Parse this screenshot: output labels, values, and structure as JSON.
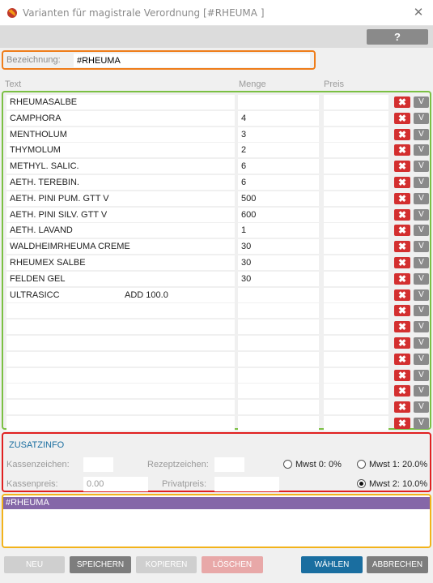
{
  "window": {
    "title": "Varianten für magistrale Verordnung [#RHEUMA ]",
    "close_glyph": "✕",
    "app_icon": "pharmacy-app-icon"
  },
  "toolbar": {
    "help_label": "?"
  },
  "bezeichnung": {
    "label": "Bezeichnung:",
    "value": "#RHEUMA"
  },
  "columns": {
    "text": "Text",
    "menge": "Menge",
    "preis": "Preis"
  },
  "row_buttons": {
    "delete_glyph": "✖",
    "v_label": "V"
  },
  "rows": [
    {
      "text": "RHEUMASALBE",
      "extra": "",
      "menge": "",
      "preis": ""
    },
    {
      "text": "CAMPHORA",
      "extra": "",
      "menge": "4",
      "preis": ""
    },
    {
      "text": "MENTHOLUM",
      "extra": "",
      "menge": "3",
      "preis": ""
    },
    {
      "text": "THYMOLUM",
      "extra": "",
      "menge": "2",
      "preis": ""
    },
    {
      "text": "METHYL. SALIC.",
      "extra": "",
      "menge": "6",
      "preis": ""
    },
    {
      "text": "AETH. TEREBIN.",
      "extra": "",
      "menge": "6",
      "preis": ""
    },
    {
      "text": "AETH. PINI PUM. GTT V",
      "extra": "",
      "menge": "500",
      "preis": ""
    },
    {
      "text": "AETH. PINI SILV. GTT V",
      "extra": "",
      "menge": "600",
      "preis": ""
    },
    {
      "text": "AETH. LAVAND",
      "extra": "",
      "menge": "1",
      "preis": ""
    },
    {
      "text": "WALDHEIMRHEUMA CREME",
      "extra": "",
      "menge": "30",
      "preis": ""
    },
    {
      "text": "RHEUMEX SALBE",
      "extra": "",
      "menge": "30",
      "preis": ""
    },
    {
      "text": "FELDEN GEL",
      "extra": "",
      "menge": "30",
      "preis": ""
    },
    {
      "text": "ULTRASICC",
      "extra": "ADD 100.0",
      "menge": "",
      "preis": ""
    },
    {
      "text": "",
      "extra": "",
      "menge": "",
      "preis": ""
    },
    {
      "text": "",
      "extra": "",
      "menge": "",
      "preis": ""
    },
    {
      "text": "",
      "extra": "",
      "menge": "",
      "preis": ""
    },
    {
      "text": "",
      "extra": "",
      "menge": "",
      "preis": ""
    },
    {
      "text": "",
      "extra": "",
      "menge": "",
      "preis": ""
    },
    {
      "text": "",
      "extra": "",
      "menge": "",
      "preis": ""
    },
    {
      "text": "",
      "extra": "",
      "menge": "",
      "preis": ""
    },
    {
      "text": "",
      "extra": "",
      "menge": "",
      "preis": ""
    }
  ],
  "zusatz": {
    "title": "ZUSATZINFO",
    "kassenzeichen_label": "Kassenzeichen:",
    "kassenzeichen_value": "",
    "rezeptzeichen_label": "Rezeptzeichen:",
    "rezeptzeichen_value": "",
    "kassenpreis_label": "Kassenpreis:",
    "kassenpreis_value": "0.00",
    "privatpreis_label": "Privatpreis:",
    "privatpreis_value": "",
    "mwst": [
      {
        "label": "Mwst 0: 0%",
        "checked": false
      },
      {
        "label": "Mwst 1: 20.0%",
        "checked": false
      },
      {
        "label": "Mwst 2: 10.0%",
        "checked": true
      }
    ]
  },
  "note": {
    "header": "#RHEUMA",
    "body": ""
  },
  "buttons": {
    "neu": "NEU",
    "speichern": "SPEICHERN",
    "kopieren": "KOPIEREN",
    "loeschen": "LÖSCHEN",
    "waehlen": "WÄHLEN",
    "abbrechen": "ABBRECHEN"
  },
  "colors": {
    "bez_border": "#ef7d1a",
    "grid_border": "#7bc043",
    "zusatz_border": "#e02020",
    "note_border": "#f2b31b",
    "note_header": "#8567a8",
    "primary_button": "#1a6ea0",
    "delete_red": "#d32f2f"
  }
}
